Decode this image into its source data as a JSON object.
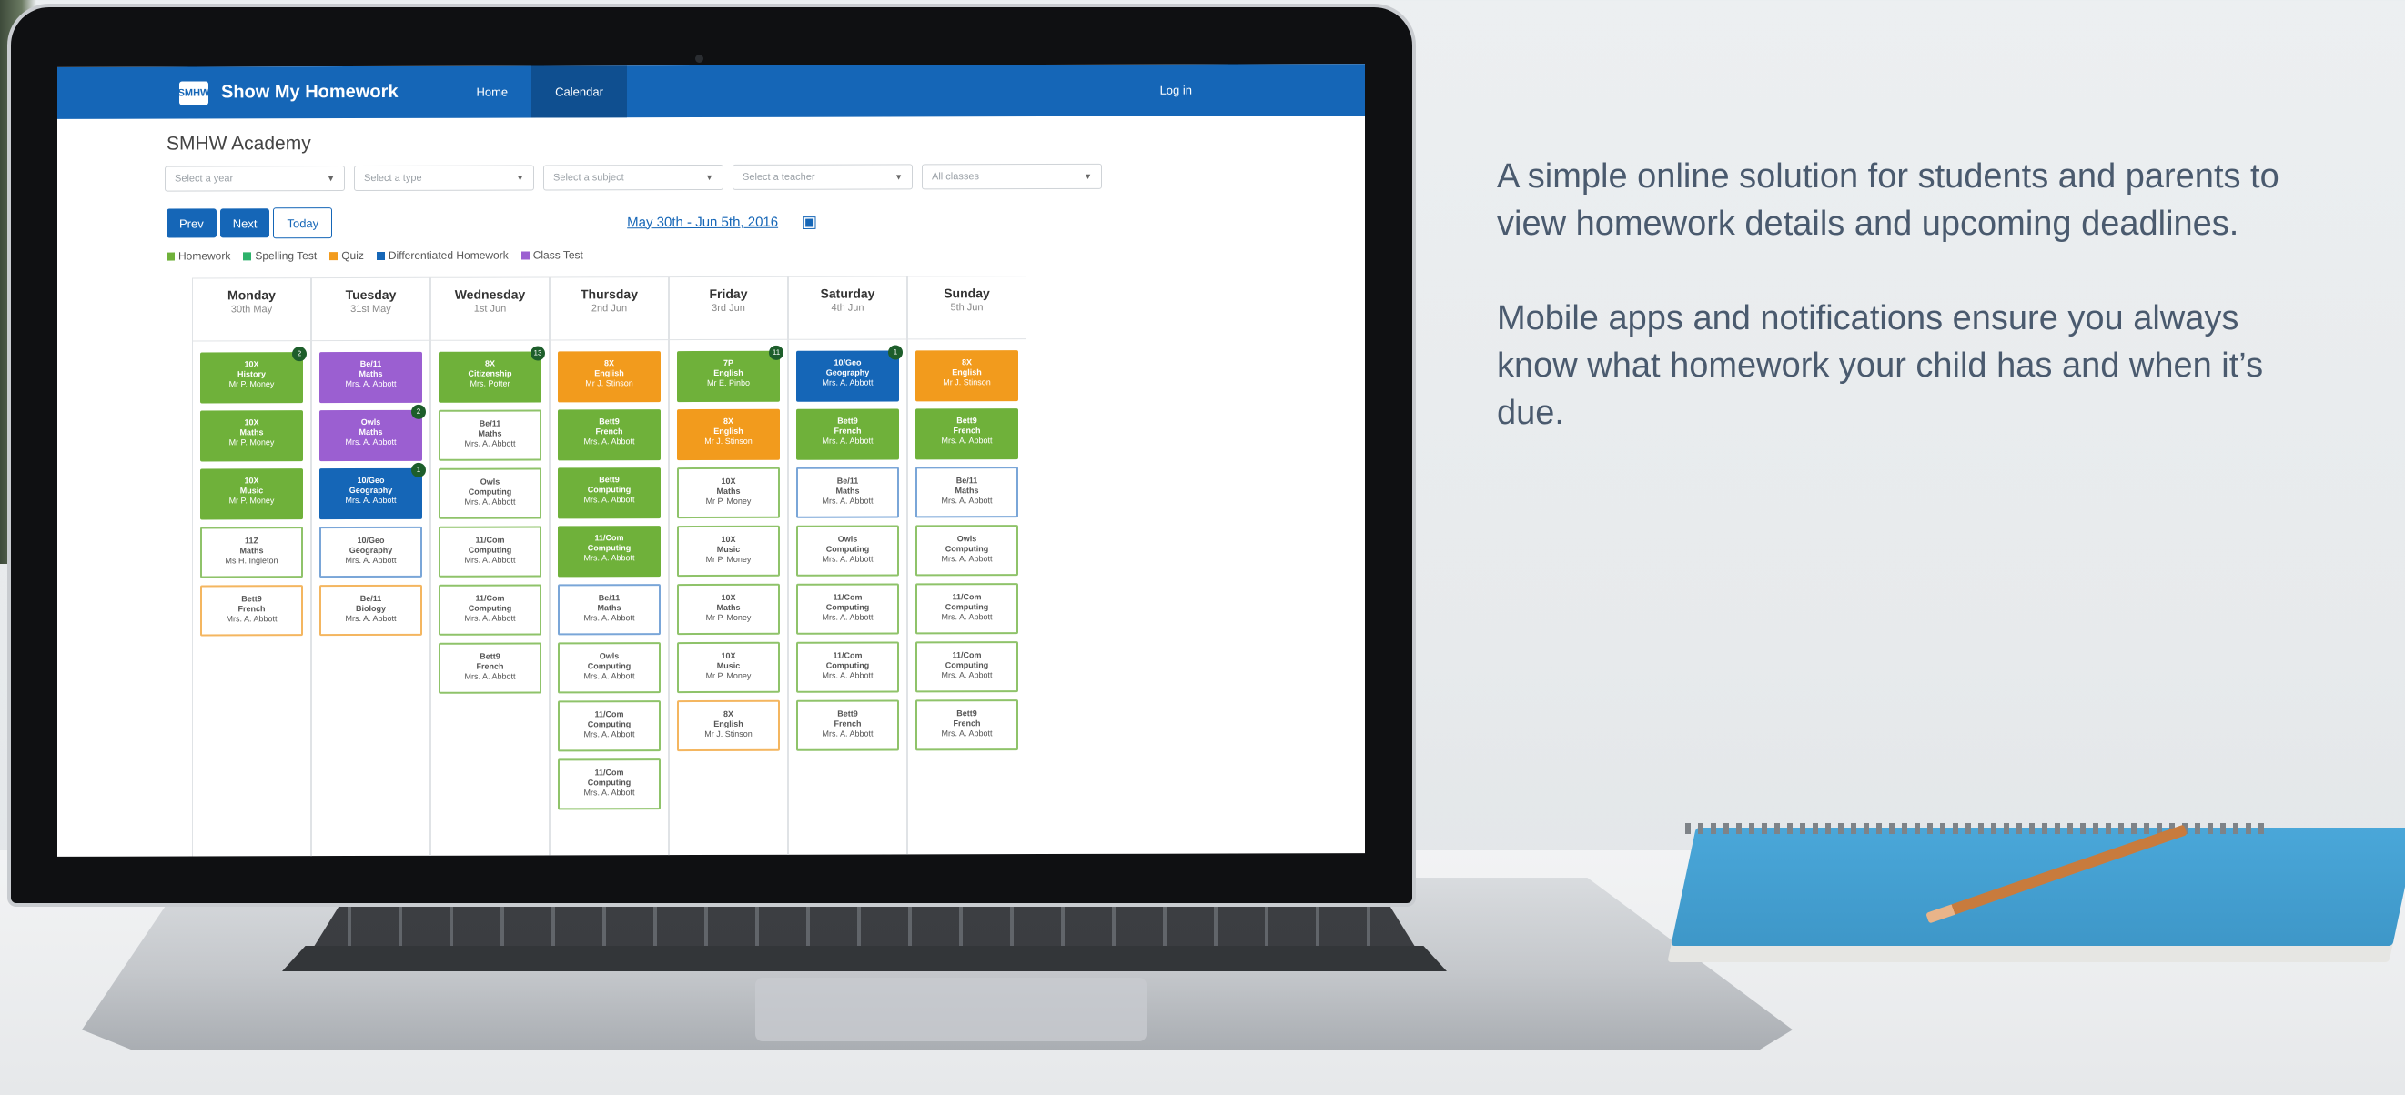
{
  "app": {
    "brand": "Show My Homework",
    "logo_text": "SMHW",
    "nav": [
      "Home",
      "Calendar"
    ],
    "login": "Log in",
    "school": "SMHW Academy"
  },
  "filters": [
    "Select a year",
    "Select a type",
    "Select a subject",
    "Select a teacher",
    "All classes"
  ],
  "controls": {
    "prev": "Prev",
    "next": "Next",
    "today": "Today",
    "range": "May 30th - Jun 5th, 2016"
  },
  "legend": [
    {
      "label": "Homework",
      "color": "#6fb13a"
    },
    {
      "label": "Spelling Test",
      "color": "#2db26b"
    },
    {
      "label": "Quiz",
      "color": "#f29b1d"
    },
    {
      "label": "Differentiated Homework",
      "color": "#1566b7"
    },
    {
      "label": "Class Test",
      "color": "#9b5fd1"
    }
  ],
  "days": [
    {
      "name": "Monday",
      "date": "30th May",
      "cards": [
        {
          "style": "g",
          "title": "10X",
          "subject": "History",
          "teacher": "Mr P. Money",
          "badge": "2"
        },
        {
          "style": "g",
          "title": "10X",
          "subject": "Maths",
          "teacher": "Mr P. Money"
        },
        {
          "style": "g",
          "title": "10X",
          "subject": "Music",
          "teacher": "Mr P. Money"
        },
        {
          "style": "wg",
          "title": "11Z",
          "subject": "Maths",
          "teacher": "Ms H. Ingleton"
        },
        {
          "style": "wo",
          "title": "Bett9",
          "subject": "French",
          "teacher": "Mrs. A. Abbott"
        }
      ]
    },
    {
      "name": "Tuesday",
      "date": "31st May",
      "cards": [
        {
          "style": "p",
          "title": "Be/11",
          "subject": "Maths",
          "teacher": "Mrs. A. Abbott"
        },
        {
          "style": "p",
          "title": "Owls",
          "subject": "Maths",
          "teacher": "Mrs. A. Abbott",
          "badge": "2"
        },
        {
          "style": "b",
          "title": "10/Geo",
          "subject": "Geography",
          "teacher": "Mrs. A. Abbott",
          "badge": "1"
        },
        {
          "style": "wb",
          "title": "10/Geo",
          "subject": "Geography",
          "teacher": "Mrs. A. Abbott"
        },
        {
          "style": "wo",
          "title": "Be/11",
          "subject": "Biology",
          "teacher": "Mrs. A. Abbott"
        }
      ]
    },
    {
      "name": "Wednesday",
      "date": "1st Jun",
      "cards": [
        {
          "style": "g",
          "title": "8X",
          "subject": "Citizenship",
          "teacher": "Mrs. Potter",
          "badge": "13"
        },
        {
          "style": "wg",
          "title": "Be/11",
          "subject": "Maths",
          "teacher": "Mrs. A. Abbott"
        },
        {
          "style": "wg",
          "title": "Owls",
          "subject": "Computing",
          "teacher": "Mrs. A. Abbott"
        },
        {
          "style": "wg",
          "title": "11/Com",
          "subject": "Computing",
          "teacher": "Mrs. A. Abbott"
        },
        {
          "style": "wg",
          "title": "11/Com",
          "subject": "Computing",
          "teacher": "Mrs. A. Abbott"
        },
        {
          "style": "wg",
          "title": "Bett9",
          "subject": "French",
          "teacher": "Mrs. A. Abbott"
        }
      ]
    },
    {
      "name": "Thursday",
      "date": "2nd Jun",
      "cards": [
        {
          "style": "o",
          "title": "8X",
          "subject": "English",
          "teacher": "Mr J. Stinson"
        },
        {
          "style": "g",
          "title": "Bett9",
          "subject": "French",
          "teacher": "Mrs. A. Abbott"
        },
        {
          "style": "g",
          "title": "Bett9",
          "subject": "Computing",
          "teacher": "Mrs. A. Abbott"
        },
        {
          "style": "g",
          "title": "11/Com",
          "subject": "Computing",
          "teacher": "Mrs. A. Abbott"
        },
        {
          "style": "wb",
          "title": "Be/11",
          "subject": "Maths",
          "teacher": "Mrs. A. Abbott"
        },
        {
          "style": "wg",
          "title": "Owls",
          "subject": "Computing",
          "teacher": "Mrs. A. Abbott"
        },
        {
          "style": "wg",
          "title": "11/Com",
          "subject": "Computing",
          "teacher": "Mrs. A. Abbott"
        },
        {
          "style": "wg",
          "title": "11/Com",
          "subject": "Computing",
          "teacher": "Mrs. A. Abbott"
        }
      ]
    },
    {
      "name": "Friday",
      "date": "3rd Jun",
      "cards": [
        {
          "style": "g",
          "title": "7P",
          "subject": "English",
          "teacher": "Mr E. Pinbo",
          "badge": "11"
        },
        {
          "style": "o",
          "title": "8X",
          "subject": "English",
          "teacher": "Mr J. Stinson"
        },
        {
          "style": "wg",
          "title": "10X",
          "subject": "Maths",
          "teacher": "Mr P. Money"
        },
        {
          "style": "wg",
          "title": "10X",
          "subject": "Music",
          "teacher": "Mr P. Money"
        },
        {
          "style": "wg",
          "title": "10X",
          "subject": "Maths",
          "teacher": "Mr P. Money"
        },
        {
          "style": "wg",
          "title": "10X",
          "subject": "Music",
          "teacher": "Mr P. Money"
        },
        {
          "style": "wo",
          "title": "8X",
          "subject": "English",
          "teacher": "Mr J. Stinson"
        }
      ]
    },
    {
      "name": "Saturday",
      "date": "4th Jun",
      "cards": [
        {
          "style": "b",
          "title": "10/Geo",
          "subject": "Geography",
          "teacher": "Mrs. A. Abbott",
          "badge": "1"
        },
        {
          "style": "g",
          "title": "Bett9",
          "subject": "French",
          "teacher": "Mrs. A. Abbott"
        },
        {
          "style": "wb",
          "title": "Be/11",
          "subject": "Maths",
          "teacher": "Mrs. A. Abbott"
        },
        {
          "style": "wg",
          "title": "Owls",
          "subject": "Computing",
          "teacher": "Mrs. A. Abbott"
        },
        {
          "style": "wg",
          "title": "11/Com",
          "subject": "Computing",
          "teacher": "Mrs. A. Abbott"
        },
        {
          "style": "wg",
          "title": "11/Com",
          "subject": "Computing",
          "teacher": "Mrs. A. Abbott"
        },
        {
          "style": "wg",
          "title": "Bett9",
          "subject": "French",
          "teacher": "Mrs. A. Abbott"
        }
      ]
    },
    {
      "name": "Sunday",
      "date": "5th Jun",
      "cards": [
        {
          "style": "o",
          "title": "8X",
          "subject": "English",
          "teacher": "Mr J. Stinson"
        },
        {
          "style": "g",
          "title": "Bett9",
          "subject": "French",
          "teacher": "Mrs. A. Abbott"
        },
        {
          "style": "wb",
          "title": "Be/11",
          "subject": "Maths",
          "teacher": "Mrs. A. Abbott"
        },
        {
          "style": "wg",
          "title": "Owls",
          "subject": "Computing",
          "teacher": "Mrs. A. Abbott"
        },
        {
          "style": "wg",
          "title": "11/Com",
          "subject": "Computing",
          "teacher": "Mrs. A. Abbott"
        },
        {
          "style": "wg",
          "title": "11/Com",
          "subject": "Computing",
          "teacher": "Mrs. A. Abbott"
        },
        {
          "style": "wg",
          "title": "Bett9",
          "subject": "French",
          "teacher": "Mrs. A. Abbott"
        }
      ]
    }
  ],
  "copy": {
    "p1": "A simple online solution for students and parents to view homework details and upcoming deadlines.",
    "p2": "Mobile apps and notifications ensure you always know what homework your child has and when it’s due."
  }
}
